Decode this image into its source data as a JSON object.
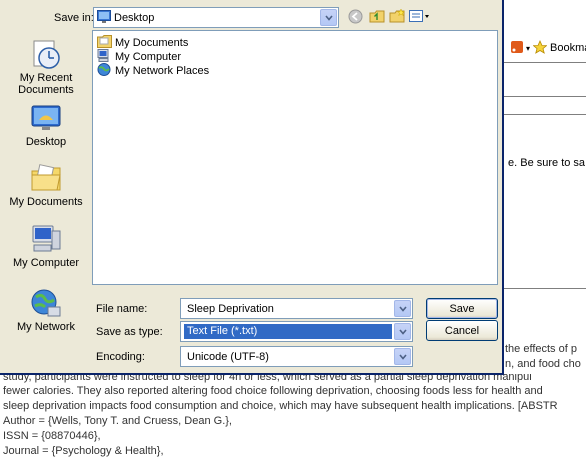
{
  "dialog": {
    "save_in_label": "Save in:",
    "save_in_value": "Desktop",
    "places": [
      {
        "id": "recent",
        "label": "My Recent Documents"
      },
      {
        "id": "desktop",
        "label": "Desktop"
      },
      {
        "id": "documents",
        "label": "My Documents"
      },
      {
        "id": "computer",
        "label": "My Computer"
      },
      {
        "id": "network",
        "label": "My Network"
      }
    ],
    "files": [
      "My Documents",
      "My Computer",
      "My Network Places"
    ],
    "file_name_label": "File name:",
    "file_name_value": "Sleep Deprivation",
    "save_as_type_label": "Save as type:",
    "save_as_type_value": "Text File (*.txt)",
    "encoding_label": "Encoding:",
    "encoding_value": "Unicode (UTF-8)",
    "save_button": "Save",
    "cancel_button": "Cancel"
  },
  "background": {
    "toolbar_bookmarks": "Bookma",
    "snippet": "e.  Be sure to sa",
    "para_right_1": "the effects of p",
    "para_right_2": "n, and food cho",
    "lines": [
      "study, participants were instructed to sleep for 4h or less, which served as a partial sleep deprivation manipul",
      "fewer calories. They also reported altering food choice following deprivation, choosing foods less for health and",
      "sleep deprivation impacts food consumption and choice, which may have subsequent health implications. [ABSTR",
      "Author = {Wells, Tony T. and Cruess, Dean G.},",
      "ISSN = {08870446},",
      "Journal = {Psychology & Health},"
    ]
  }
}
